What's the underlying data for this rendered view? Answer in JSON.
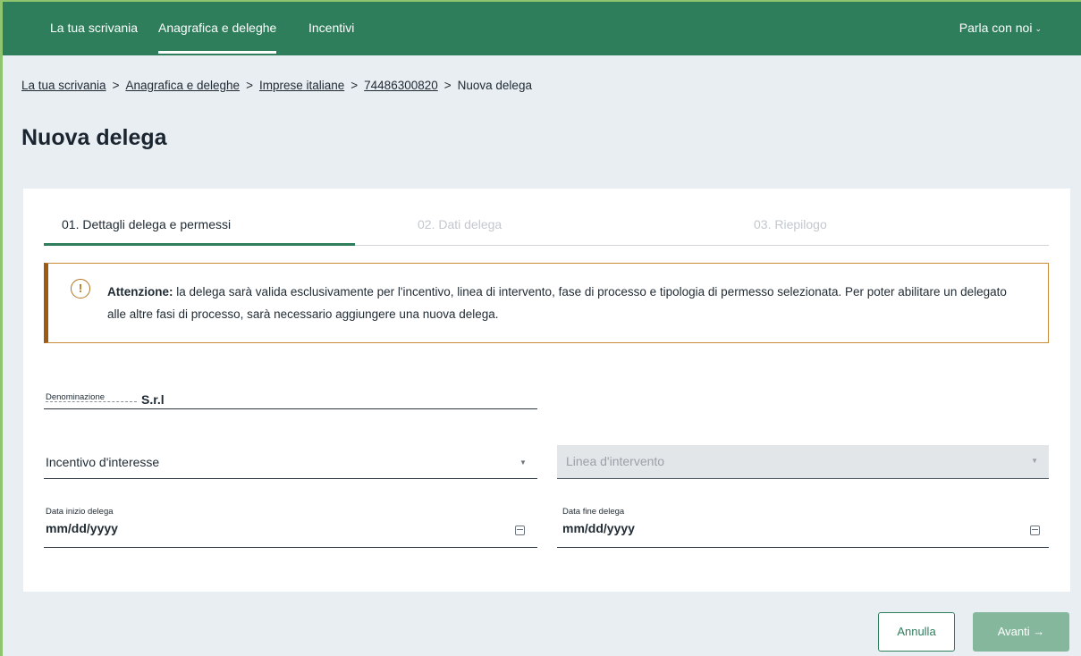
{
  "nav": {
    "items": [
      {
        "label": "La tua scrivania"
      },
      {
        "label": "Anagrafica e deleghe"
      },
      {
        "label": "Incentivi"
      }
    ],
    "right_label": "Parla con noi",
    "right_chevron": "⌄"
  },
  "breadcrumb": {
    "items": [
      "La tua scrivania",
      "Anagrafica e deleghe",
      "Imprese italiane",
      "74486300820"
    ],
    "current": "Nuova delega",
    "separator": ">"
  },
  "page_title": "Nuova delega",
  "steps": [
    {
      "label": "01. Dettagli delega e permessi",
      "active": true
    },
    {
      "label": "02. Dati delega",
      "active": false
    },
    {
      "label": "03. Riepilogo",
      "active": false
    }
  ],
  "alert": {
    "icon": "!",
    "bold": "Attenzione:",
    "text": " la delega sarà valida esclusivamente per l'incentivo, linea di intervento, fase di processo e tipologia di permesso selezionata. Per poter abilitare un delegato alle altre fasi di processo, sarà necessario aggiungere una nuova delega."
  },
  "form": {
    "denominazione_label": "Denominazione",
    "denominazione_value": "S.r.l",
    "incentivo_placeholder": "Incentivo d'interesse",
    "linea_placeholder": "Linea d'intervento",
    "data_inizio_label": "Data inizio delega",
    "data_inizio_value": "mm/dd/yyyy",
    "data_fine_label": "Data fine delega",
    "data_fine_value": "mm/dd/yyyy"
  },
  "buttons": {
    "cancel": "Annulla",
    "next": "Avanti →"
  },
  "colors": {
    "brand_green": "#2e7d5b",
    "disabled_green": "#85b79c",
    "alert_border": "#9c5a12"
  }
}
